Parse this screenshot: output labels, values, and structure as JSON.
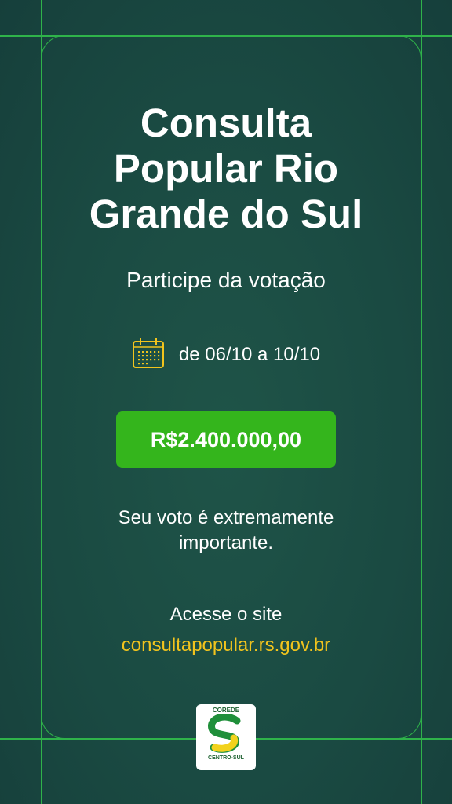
{
  "title_lines": [
    "Consulta",
    "Popular Rio",
    "Grande do Sul"
  ],
  "subtitle": "Participe da votação",
  "date_range": "de 06/10 a 10/10",
  "amount": "R$2.400.000,00",
  "message_lines": [
    "Seu voto é extremamente",
    "importante."
  ],
  "access_label": "Acesse o site",
  "site_url": "consultapopular.rs.gov.br",
  "logo": {
    "top_text": "COREDE",
    "bottom_text": "CENTRO-SUL"
  },
  "icons": {
    "calendar": "calendar-icon"
  },
  "colors": {
    "background": "#1a4a42",
    "accent_green": "#34b51c",
    "frame_line": "#2fb34a",
    "link_yellow": "#f2c41d"
  }
}
